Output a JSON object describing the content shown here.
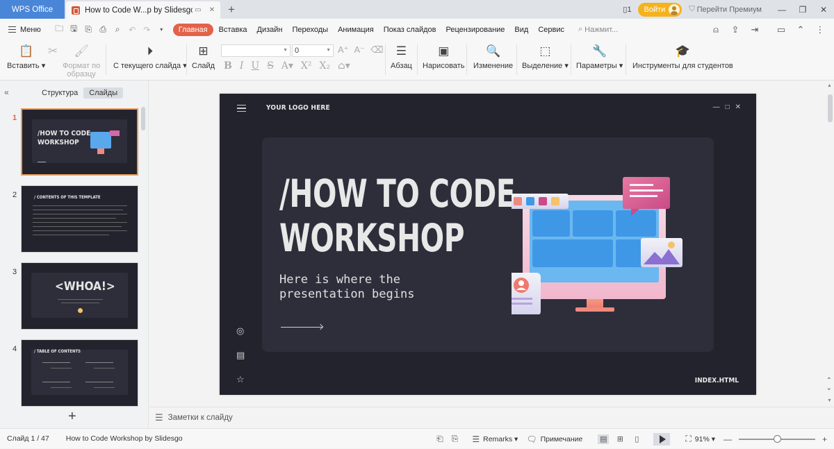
{
  "titlebar": {
    "app_tab": "WPS Office",
    "doc_tab": "How to Code W...p by Slidesgo",
    "login": "Войти",
    "premium": "Перейти Премиум"
  },
  "menubar": {
    "menu": "Меню",
    "tabs": [
      "Главная",
      "Вставка",
      "Дизайн",
      "Переходы",
      "Анимация",
      "Показ слайдов",
      "Рецензирование",
      "Вид",
      "Сервис"
    ],
    "active_tab": "Главная",
    "search_placeholder": "Нажмит..."
  },
  "toolbar": {
    "paste": "Вставить",
    "format_painter_1": "Формат по",
    "format_painter_2": "образцу",
    "from_current": "С текущего слайда",
    "slide": "Слайд",
    "font_size": "0",
    "paragraph": "Абзац",
    "draw": "Нарисовать",
    "change": "Изменение",
    "selection": "Выделение",
    "params": "Параметры",
    "student_tools": "Инструменты для студентов"
  },
  "leftpanel": {
    "tab_structure": "Структура",
    "tab_slides": "Слайды",
    "slides": [
      {
        "num": "1",
        "title": "/HOW TO CODE WORKSHOP"
      },
      {
        "num": "2",
        "title": "/ CONTENTS OF THIS TEMPLATE"
      },
      {
        "num": "3",
        "title": "<WHOA!>"
      },
      {
        "num": "4",
        "title": "/ TABLE OF CONTENTS"
      }
    ]
  },
  "slide": {
    "logo": "YOUR LOGO HERE",
    "title_line1": "/HOW TO CODE",
    "title_line2": "WORKSHOP",
    "subtitle": "Here is where the\npresentation begins",
    "footer": "INDEX.HTML"
  },
  "notes": {
    "placeholder": "Заметки к слайду"
  },
  "statusbar": {
    "slide_counter": "Слайд 1 / 47",
    "doc_name": "How to Code Workshop by Slidesgo",
    "remarks": "Remarks",
    "comment": "Примечание",
    "zoom": "91%"
  },
  "colors": {
    "accent": "#e3624a",
    "slide_bg": "#23232d",
    "card_bg": "#2e2e3b",
    "wps_blue": "#4a86d8",
    "login_yellow": "#f5b21c"
  }
}
